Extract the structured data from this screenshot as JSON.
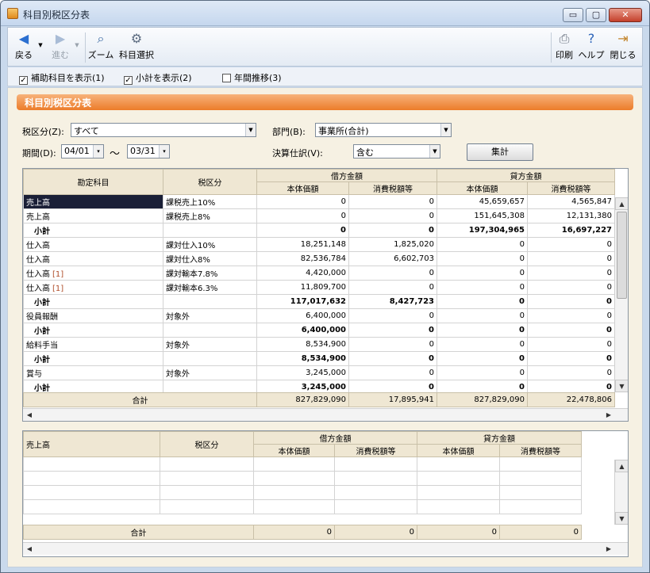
{
  "window": {
    "title": "科目別税区分表",
    "minimize": "▭",
    "maximize": "▢",
    "close": "✕"
  },
  "toolbar": {
    "back": "戻る",
    "forward": "進む",
    "zoom": "ズーム",
    "select_account": "科目選択",
    "print": "印刷",
    "help": "ヘルプ",
    "close": "閉じる"
  },
  "options": {
    "show_sub_account": {
      "label": "補助科目を表示(1)",
      "checked": true
    },
    "show_subtotal": {
      "label": "小計を表示(2)",
      "checked": true
    },
    "annual_trend": {
      "label": "年間推移(3)",
      "checked": false
    }
  },
  "panel_title": "科目別税区分表",
  "filters": {
    "tax_category_label": "税区分(Z):",
    "tax_category_value": "すべて",
    "department_label": "部門(B):",
    "department_value": "事業所(合計)",
    "period_label": "期間(D):",
    "period_from": "04/01",
    "period_to": "03/31",
    "tilde": "～",
    "closing_label": "決算仕訳(V):",
    "closing_value": "含む",
    "aggregate_button": "集計"
  },
  "main_table": {
    "headers": {
      "account": "勘定科目",
      "tax": "税区分",
      "debit": "借方金額",
      "credit": "貸方金額",
      "base": "本体価額",
      "tax_amount": "消費税額等"
    },
    "rows": [
      {
        "account": "売上高",
        "tax": "課税売上10%",
        "d_base": "0",
        "d_tax": "0",
        "c_base": "45,659,657",
        "c_tax": "4,565,847",
        "type": "selected"
      },
      {
        "account": "売上高",
        "tax": "課税売上8%",
        "d_base": "0",
        "d_tax": "0",
        "c_base": "151,645,308",
        "c_tax": "12,131,380",
        "type": "normal"
      },
      {
        "account": "小計",
        "tax": "",
        "d_base": "0",
        "d_tax": "0",
        "c_base": "197,304,965",
        "c_tax": "16,697,227",
        "type": "subtotal"
      },
      {
        "account": "仕入高",
        "tax": "課対仕入10%",
        "d_base": "18,251,148",
        "d_tax": "1,825,020",
        "c_base": "0",
        "c_tax": "0",
        "type": "normal"
      },
      {
        "account": "仕入高",
        "tax": "課対仕入8%",
        "d_base": "82,536,784",
        "d_tax": "6,602,703",
        "c_base": "0",
        "c_tax": "0",
        "type": "normal"
      },
      {
        "account": "仕入高",
        "bracket": "[1]",
        "tax": "課対輸本7.8%",
        "d_base": "4,420,000",
        "d_tax": "0",
        "c_base": "0",
        "c_tax": "0",
        "type": "normal"
      },
      {
        "account": "仕入高",
        "bracket": "[1]",
        "tax": "課対輸本6.3%",
        "d_base": "11,809,700",
        "d_tax": "0",
        "c_base": "0",
        "c_tax": "0",
        "type": "normal"
      },
      {
        "account": "小計",
        "tax": "",
        "d_base": "117,017,632",
        "d_tax": "8,427,723",
        "c_base": "0",
        "c_tax": "0",
        "type": "subtotal"
      },
      {
        "account": "役員報酬",
        "tax": "対象外",
        "d_base": "6,400,000",
        "d_tax": "0",
        "c_base": "0",
        "c_tax": "0",
        "type": "normal"
      },
      {
        "account": "小計",
        "tax": "",
        "d_base": "6,400,000",
        "d_tax": "0",
        "c_base": "0",
        "c_tax": "0",
        "type": "subtotal"
      },
      {
        "account": "給料手当",
        "tax": "対象外",
        "d_base": "8,534,900",
        "d_tax": "0",
        "c_base": "0",
        "c_tax": "0",
        "type": "normal"
      },
      {
        "account": "小計",
        "tax": "",
        "d_base": "8,534,900",
        "d_tax": "0",
        "c_base": "0",
        "c_tax": "0",
        "type": "subtotal"
      },
      {
        "account": "賞与",
        "tax": "対象外",
        "d_base": "3,245,000",
        "d_tax": "0",
        "c_base": "0",
        "c_tax": "0",
        "type": "normal"
      },
      {
        "account": "小計",
        "tax": "",
        "d_base": "3,245,000",
        "d_tax": "0",
        "c_base": "0",
        "c_tax": "0",
        "type": "subtotal"
      }
    ],
    "total": {
      "label": "合計",
      "d_base": "827,829,090",
      "d_tax": "17,895,941",
      "c_base": "827,829,090",
      "c_tax": "22,478,806"
    }
  },
  "detail_table": {
    "headers": {
      "account": "売上高",
      "tax": "税区分",
      "debit": "借方金額",
      "credit": "貸方金額",
      "base": "本体価額",
      "tax_amount": "消費税額等"
    },
    "total": {
      "label": "合計",
      "d_base": "0",
      "d_tax": "0",
      "c_base": "0",
      "c_tax": "0"
    }
  }
}
